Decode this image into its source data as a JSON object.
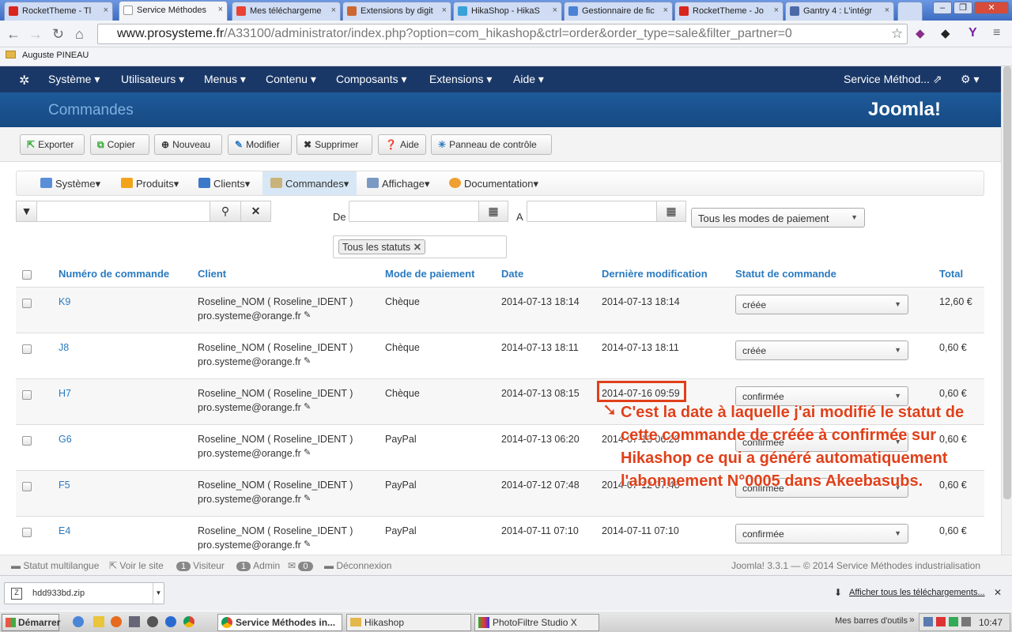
{
  "browser": {
    "tabs": [
      {
        "label": "RocketTheme - Tl",
        "color": "#d9251d"
      },
      {
        "label": "Service Méthodes",
        "color": "#ffffff"
      },
      {
        "label": "Mes téléchargeme",
        "color": "#e94235"
      },
      {
        "label": "Extensions by digit",
        "color": "#cc6633"
      },
      {
        "label": "HikaShop - HikaS",
        "color": "#3aa0d8"
      },
      {
        "label": "Gestionnaire de fic",
        "color": "#4a82d6"
      },
      {
        "label": "RocketTheme - Jo",
        "color": "#d9251d"
      },
      {
        "label": "Gantry 4 : L'intégr",
        "color": "#4d6aa8"
      }
    ],
    "url_host": "www.prosysteme.fr",
    "url_path": "/A33100/administrator/index.php?option=com_hikashop&ctrl=order&order_type=sale&filter_partner=0",
    "bookmark": "Auguste PINEAU"
  },
  "joomla_nav": {
    "items": [
      "Système ▾",
      "Utilisateurs ▾",
      "Menus ▾",
      "Contenu ▾",
      "Composants ▾",
      "Extensions ▾",
      "Aide ▾"
    ],
    "site_link": "Service Méthod... ⇗",
    "gear": "⚙ ▾"
  },
  "header": {
    "title": "Commandes",
    "logo": "Joomla!"
  },
  "toolbar": {
    "buttons": [
      "Exporter",
      "Copier",
      "Nouveau",
      "Modifier",
      "Supprimer",
      "Aide",
      "Panneau de contrôle"
    ]
  },
  "hika_menu": {
    "items": [
      "Système",
      "Produits",
      "Clients",
      "Commandes",
      "Affichage",
      "Documentation"
    ]
  },
  "filters": {
    "from_label": "De",
    "to_label": "A",
    "payment_select": "Tous les modes de paiement",
    "status_tag": "Tous les statuts"
  },
  "table": {
    "headers": [
      "Numéro de commande",
      "Client",
      "Mode de paiement",
      "Date",
      "Dernière modification",
      "Statut de commande",
      "Total"
    ],
    "rows": [
      {
        "number": "K9",
        "client": "Roseline_NOM ( Roseline_IDENT )",
        "email": "pro.systeme@orange.fr",
        "payment": "Chèque",
        "date": "2014-07-13 18:14",
        "modified": "2014-07-13 18:14",
        "status": "créée",
        "total": "12,60 €"
      },
      {
        "number": "J8",
        "client": "Roseline_NOM ( Roseline_IDENT )",
        "email": "pro.systeme@orange.fr",
        "payment": "Chèque",
        "date": "2014-07-13 18:11",
        "modified": "2014-07-13 18:11",
        "status": "créée",
        "total": "0,60 €"
      },
      {
        "number": "H7",
        "client": "Roseline_NOM ( Roseline_IDENT )",
        "email": "pro.systeme@orange.fr",
        "payment": "Chèque",
        "date": "2014-07-13 08:15",
        "modified": "2014-07-16 09:59",
        "status": "confirmée",
        "total": "0,60 €"
      },
      {
        "number": "G6",
        "client": "Roseline_NOM ( Roseline_IDENT )",
        "email": "pro.systeme@orange.fr",
        "payment": "PayPal",
        "date": "2014-07-13 06:20",
        "modified": "2014-07-13 06:20",
        "status": "confirmée",
        "total": "0,60 €"
      },
      {
        "number": "F5",
        "client": "Roseline_NOM ( Roseline_IDENT )",
        "email": "pro.systeme@orange.fr",
        "payment": "PayPal",
        "date": "2014-07-12 07:48",
        "modified": "2014-07-12 07:48",
        "status": "confirmée",
        "total": "0,60 €"
      },
      {
        "number": "E4",
        "client": "Roseline_NOM ( Roseline_IDENT )",
        "email": "pro.systeme@orange.fr",
        "payment": "PayPal",
        "date": "2014-07-11 07:10",
        "modified": "2014-07-11 07:10",
        "status": "confirmée",
        "total": "0,60 €"
      }
    ]
  },
  "annotation": {
    "text": "C'est la date à laquelle j'ai modifié le statut de cette commande de créée à confirmée sur Hikashop ce qui a généré automatiquement l'abonnement N°0005 dans Akeebasubs.",
    "color": "#e0401a"
  },
  "status_bar": {
    "multilang": "Statut multilangue",
    "view_site": "Voir le site",
    "visitors_count": "1",
    "visitors_label": "Visiteur",
    "admin_count": "1",
    "admin_label": "Admin",
    "messages_count": "0",
    "logout": "Déconnexion",
    "copyright": "Joomla! 3.3.1 — © 2014 Service Méthodes industrialisation"
  },
  "downloads": {
    "file": "hdd933bd.zip",
    "show_all": "Afficher tous les téléchargements..."
  },
  "taskbar": {
    "start": "Démarrer",
    "tasks": [
      "Service Méthodes in...",
      "Hikashop",
      "PhotoFiltre Studio X"
    ],
    "toolbars": "Mes barres d'outils",
    "clock": "10:47"
  }
}
